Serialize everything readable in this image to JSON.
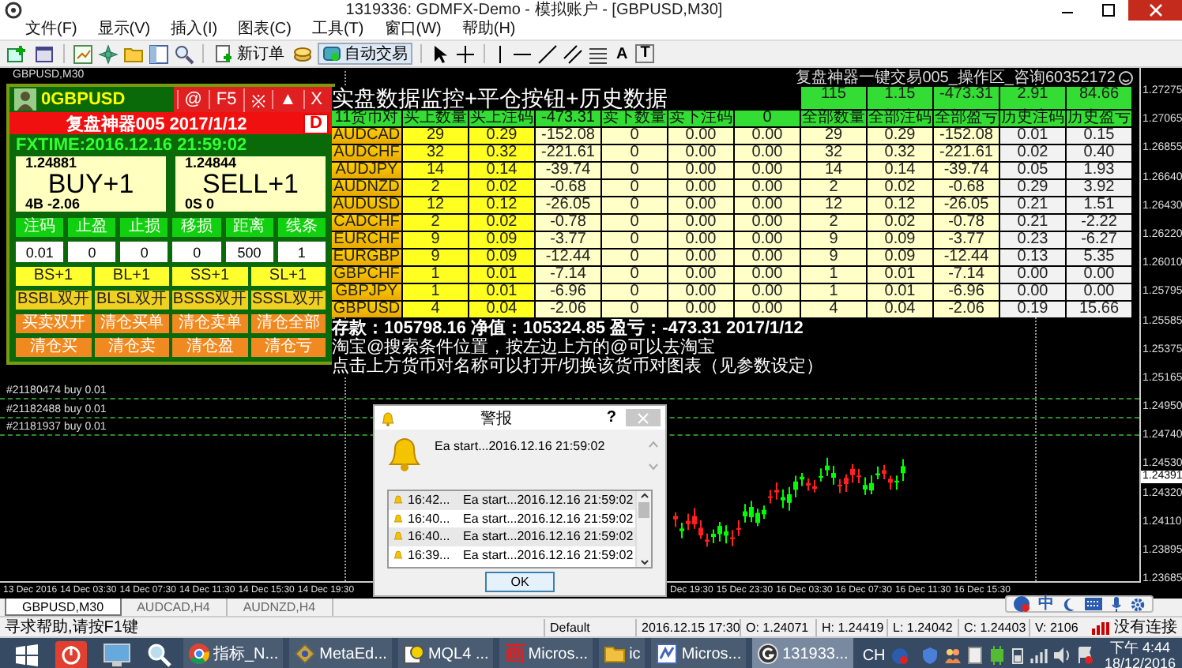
{
  "window": {
    "title": "1319336: GDMFX-Demo - 模拟账户 - [GBPUSD,M30]"
  },
  "menu": [
    "文件(F)",
    "显示(V)",
    "插入(I)",
    "图表(C)",
    "工具(T)",
    "窗口(W)",
    "帮助(H)"
  ],
  "toolbar": {
    "new_order": "新订单",
    "auto_trading": "自动交易",
    "text_tool": "A",
    "label_tool": "T"
  },
  "chart": {
    "symbol_label": "GBPUSD,M30",
    "caption": "复盘神器一键交易005_操作区_咨询60352172",
    "price_scale": [
      "1.27275",
      "1.27065",
      "1.26855",
      "1.26640",
      "1.26430",
      "1.26220",
      "1.26010",
      "1.25795",
      "1.25585",
      "1.25375",
      "1.25165",
      "1.24950",
      "1.24740",
      "1.24530",
      "1.24320",
      "1.24110",
      "1.23895",
      "1.23685"
    ],
    "current_price": "1.24391",
    "time_axis_left": [
      "13 Dec 2016",
      "14 Dec 03:30",
      "14 Dec 07:30",
      "14 Dec 11:30",
      "14 Dec 15:30",
      "14 Dec 19:30"
    ],
    "time_axis_right": [
      "Dec 19:30",
      "15 Dec 23:30",
      "16 Dec 03:30",
      "16 Dec 07:30",
      "16 Dec 11:30",
      "16 Dec 15:30"
    ],
    "order_lines": [
      "#21180474 buy 0.01",
      "#21182488 buy 0.01",
      "#21181937 buy 0.01"
    ]
  },
  "ea_panel": {
    "symbol": "0GBPUSD",
    "header_buttons": [
      "@",
      "F5",
      "※",
      "▲",
      "X"
    ],
    "title": "复盘神器005 2017/1/12",
    "title_button": "D",
    "fxtime": "FXTIME:2016.12.16 21:59:02",
    "buy": {
      "price": "1.24881",
      "label": "BUY+1",
      "info": "4B -2.06"
    },
    "sell": {
      "price": "1.24844",
      "label": "SELL+1",
      "info": "0S 0"
    },
    "param_labels": [
      "注码",
      "止盈",
      "止损",
      "移损",
      "距离",
      "线条"
    ],
    "param_values": [
      "0.01",
      "0",
      "0",
      "0",
      "500",
      "1"
    ],
    "button_rows": [
      {
        "kind": "open",
        "buttons": [
          "BS+1",
          "BL+1",
          "SS+1",
          "SL+1"
        ]
      },
      {
        "kind": "dual",
        "buttons": [
          "BSBL双开",
          "BLSL双开",
          "BSSS双开",
          "SSSL双开"
        ]
      },
      {
        "kind": "close",
        "buttons": [
          "买卖双开",
          "清仓买单",
          "清仓卖单",
          "清仓全部"
        ]
      },
      {
        "kind": "close",
        "buttons": [
          "清仓买",
          "清仓卖",
          "清仓盈",
          "清仓亏"
        ]
      }
    ]
  },
  "monitor": {
    "title": "实盘数据监控+平仓按钮+历史数据",
    "totals": [
      "115",
      "1.15",
      "-473.31",
      "2.91",
      "84.66"
    ],
    "columns": [
      "11货币对",
      "买上数量",
      "买上注码",
      "-473.31",
      "卖下数量",
      "卖下注码",
      "0",
      "全部数量",
      "全部注码",
      "全部盈亏",
      "历史注码",
      "历史盈亏"
    ],
    "rows": [
      [
        "AUDCAD",
        "29",
        "0.29",
        "-152.08",
        "0",
        "0.00",
        "0.00",
        "29",
        "0.29",
        "-152.08",
        "0.01",
        "0.15"
      ],
      [
        "AUDCHF",
        "32",
        "0.32",
        "-221.61",
        "0",
        "0.00",
        "0.00",
        "32",
        "0.32",
        "-221.61",
        "0.02",
        "0.40"
      ],
      [
        "AUDJPY",
        "14",
        "0.14",
        "-39.74",
        "0",
        "0.00",
        "0.00",
        "14",
        "0.14",
        "-39.74",
        "0.05",
        "1.93"
      ],
      [
        "AUDNZD",
        "2",
        "0.02",
        "-0.68",
        "0",
        "0.00",
        "0.00",
        "2",
        "0.02",
        "-0.68",
        "0.29",
        "3.92"
      ],
      [
        "AUDUSD",
        "12",
        "0.12",
        "-26.05",
        "0",
        "0.00",
        "0.00",
        "12",
        "0.12",
        "-26.05",
        "0.21",
        "1.51"
      ],
      [
        "CADCHF",
        "2",
        "0.02",
        "-0.78",
        "0",
        "0.00",
        "0.00",
        "2",
        "0.02",
        "-0.78",
        "0.21",
        "-2.22"
      ],
      [
        "EURCHF",
        "9",
        "0.09",
        "-3.77",
        "0",
        "0.00",
        "0.00",
        "9",
        "0.09",
        "-3.77",
        "0.23",
        "-6.27"
      ],
      [
        "EURGBP",
        "9",
        "0.09",
        "-12.44",
        "0",
        "0.00",
        "0.00",
        "9",
        "0.09",
        "-12.44",
        "0.13",
        "5.35"
      ],
      [
        "GBPCHF",
        "1",
        "0.01",
        "-7.14",
        "0",
        "0.00",
        "0.00",
        "1",
        "0.01",
        "-7.14",
        "0.00",
        "0.00"
      ],
      [
        "GBPJPY",
        "1",
        "0.01",
        "-6.96",
        "0",
        "0.00",
        "0.00",
        "1",
        "0.01",
        "-6.96",
        "0.00",
        "0.00"
      ],
      [
        "GBPUSD",
        "4",
        "0.04",
        "-2.06",
        "0",
        "0.00",
        "0.00",
        "4",
        "0.04",
        "-2.06",
        "0.19",
        "15.66"
      ]
    ],
    "summary": [
      "存款：105798.16  净值：105324.85  盈亏：-473.31  2017/1/12",
      "淘宝@搜索条件位置，按左边上方的@可以去淘宝",
      "点击上方货币对名称可以打开/切换该货币对图表（见参数设定）"
    ]
  },
  "alert": {
    "title": "警报",
    "help": "?",
    "message": "Ea start...2016.12.16 21:59:02",
    "ok": "OK",
    "entries": [
      {
        "time": "16:42...",
        "text": "Ea start...2016.12.16 21:59:02"
      },
      {
        "time": "16:40...",
        "text": "Ea start...2016.12.16 21:59:02"
      },
      {
        "time": "16:40...",
        "text": "Ea start...2016.12.16 21:59:02"
      },
      {
        "time": "16:39...",
        "text": "Ea start...2016.12.16 21:59:02"
      }
    ]
  },
  "ime_bar": {
    "mode": "中"
  },
  "chart_tabs": [
    {
      "label": "GBPUSD,M30",
      "selected": true
    },
    {
      "label": "AUDCAD,H4",
      "selected": false
    },
    {
      "label": "AUDNZD,H4",
      "selected": false
    }
  ],
  "status_bar": {
    "help": "寻求帮助,请按F1键",
    "profile": "Default",
    "datetime": "2016.12.15 17:30",
    "open": "O: 1.24071",
    "high": "H: 1.24419",
    "low": "L: 1.24042",
    "close": "C: 1.24403",
    "volume": "V: 2106",
    "connection": "没有连接"
  },
  "taskbar": {
    "items": [
      {
        "kind": "chrome",
        "label": "指标_N...",
        "selected": false
      },
      {
        "kind": "editor",
        "label": "MetaEd...",
        "selected": false
      },
      {
        "kind": "help",
        "label": "MQL4 ...",
        "selected": false
      },
      {
        "kind": "glyph",
        "glyph": "画",
        "label": "Micros...",
        "selected": false
      },
      {
        "kind": "folder",
        "label": "ic",
        "selected": false
      },
      {
        "kind": "studio",
        "label": "Micros...",
        "selected": false
      },
      {
        "kind": "terminal",
        "label": "131933...",
        "selected": true
      }
    ],
    "language": "CH",
    "time": "下午 4:44",
    "date": "18/12/2016"
  }
}
